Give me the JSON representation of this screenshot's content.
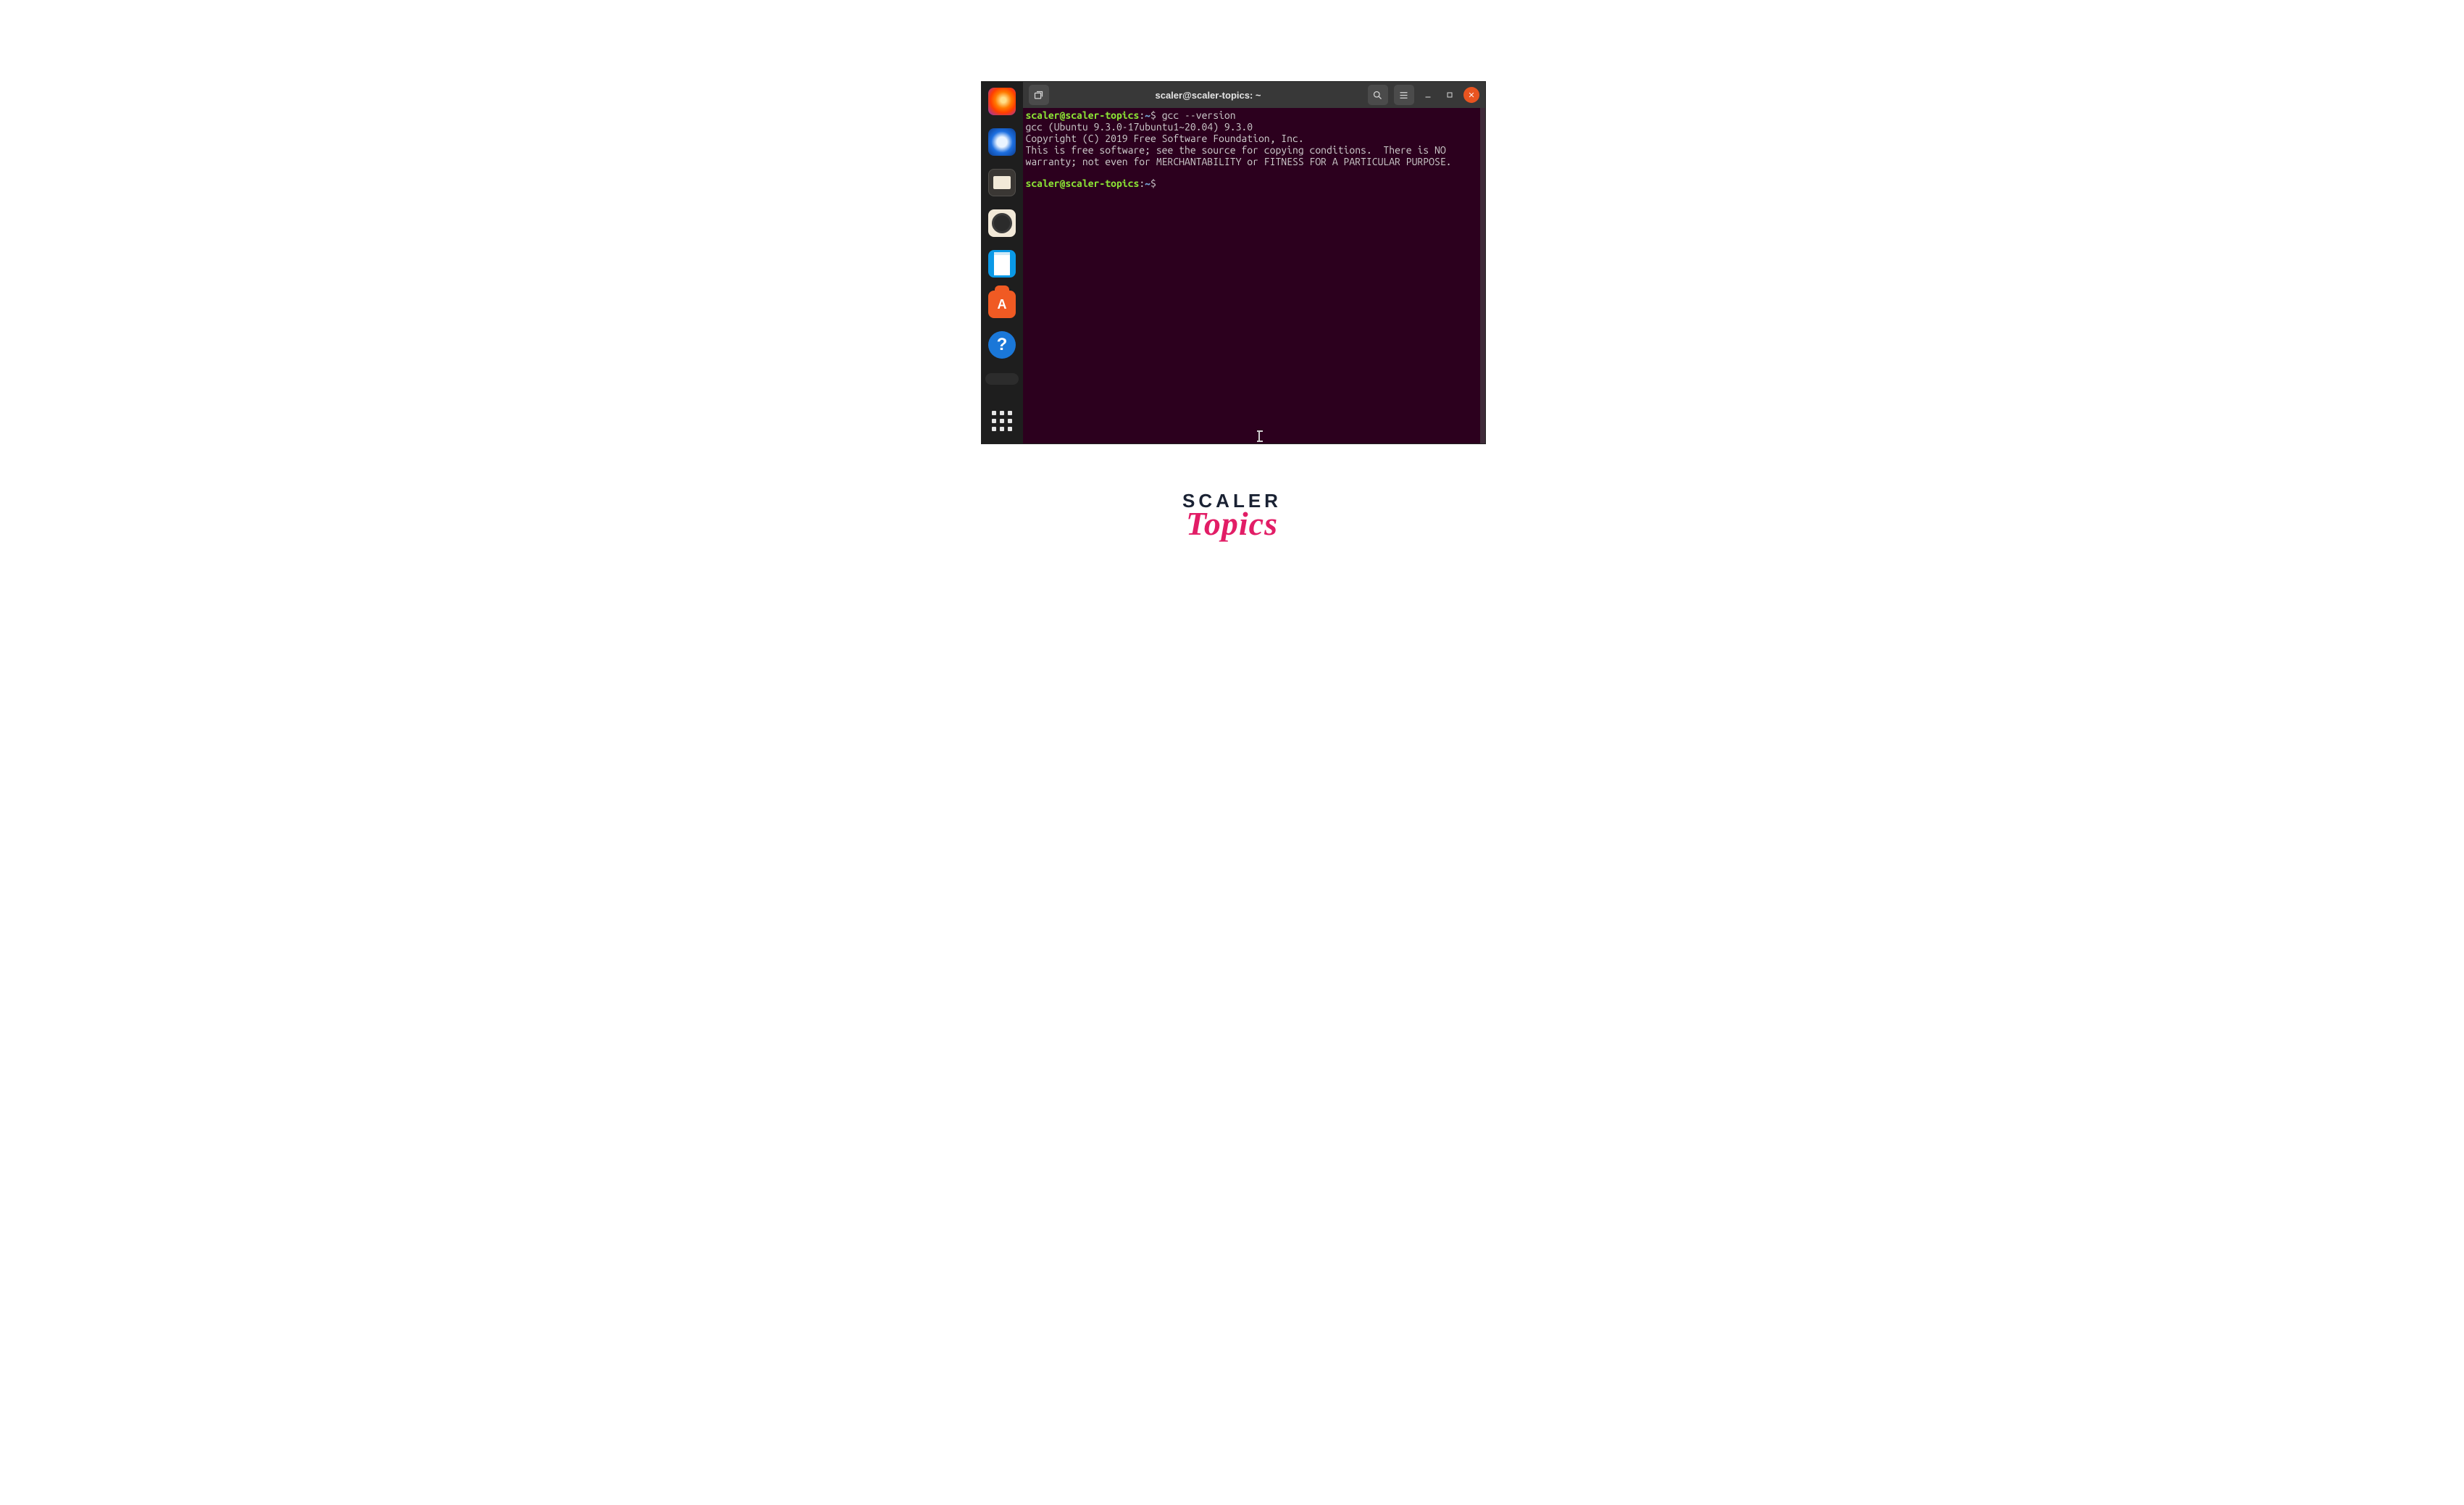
{
  "dock": {
    "items": [
      {
        "name": "firefox-icon"
      },
      {
        "name": "thunderbird-icon"
      },
      {
        "name": "files-icon"
      },
      {
        "name": "rhythmbox-icon"
      },
      {
        "name": "libreoffice-writer-icon"
      },
      {
        "name": "ubuntu-software-icon"
      },
      {
        "name": "help-icon"
      }
    ],
    "apps_name": "show-applications-icon",
    "help_glyph": "?"
  },
  "titlebar": {
    "new_tab_name": "new-tab-icon",
    "title": "scaler@scaler-topics: ~",
    "search_name": "search-icon",
    "menu_name": "hamburger-menu-icon",
    "min_name": "minimize-icon",
    "restore_name": "restore-icon",
    "close_name": "close-icon"
  },
  "terminal": {
    "prompt1": {
      "user": "scaler@scaler-topics",
      "sep": ":",
      "path": "~",
      "dollar": "$",
      "command": "gcc --version"
    },
    "output": "gcc (Ubuntu 9.3.0-17ubuntu1~20.04) 9.3.0\nCopyright (C) 2019 Free Software Foundation, Inc.\nThis is free software; see the source for copying conditions.  There is NO\nwarranty; not even for MERCHANTABILITY or FITNESS FOR A PARTICULAR PURPOSE.",
    "prompt2": {
      "user": "scaler@scaler-topics",
      "sep": ":",
      "path": "~",
      "dollar": "$"
    }
  },
  "watermark": {
    "line1": "SCALER",
    "line2": "Topics"
  }
}
